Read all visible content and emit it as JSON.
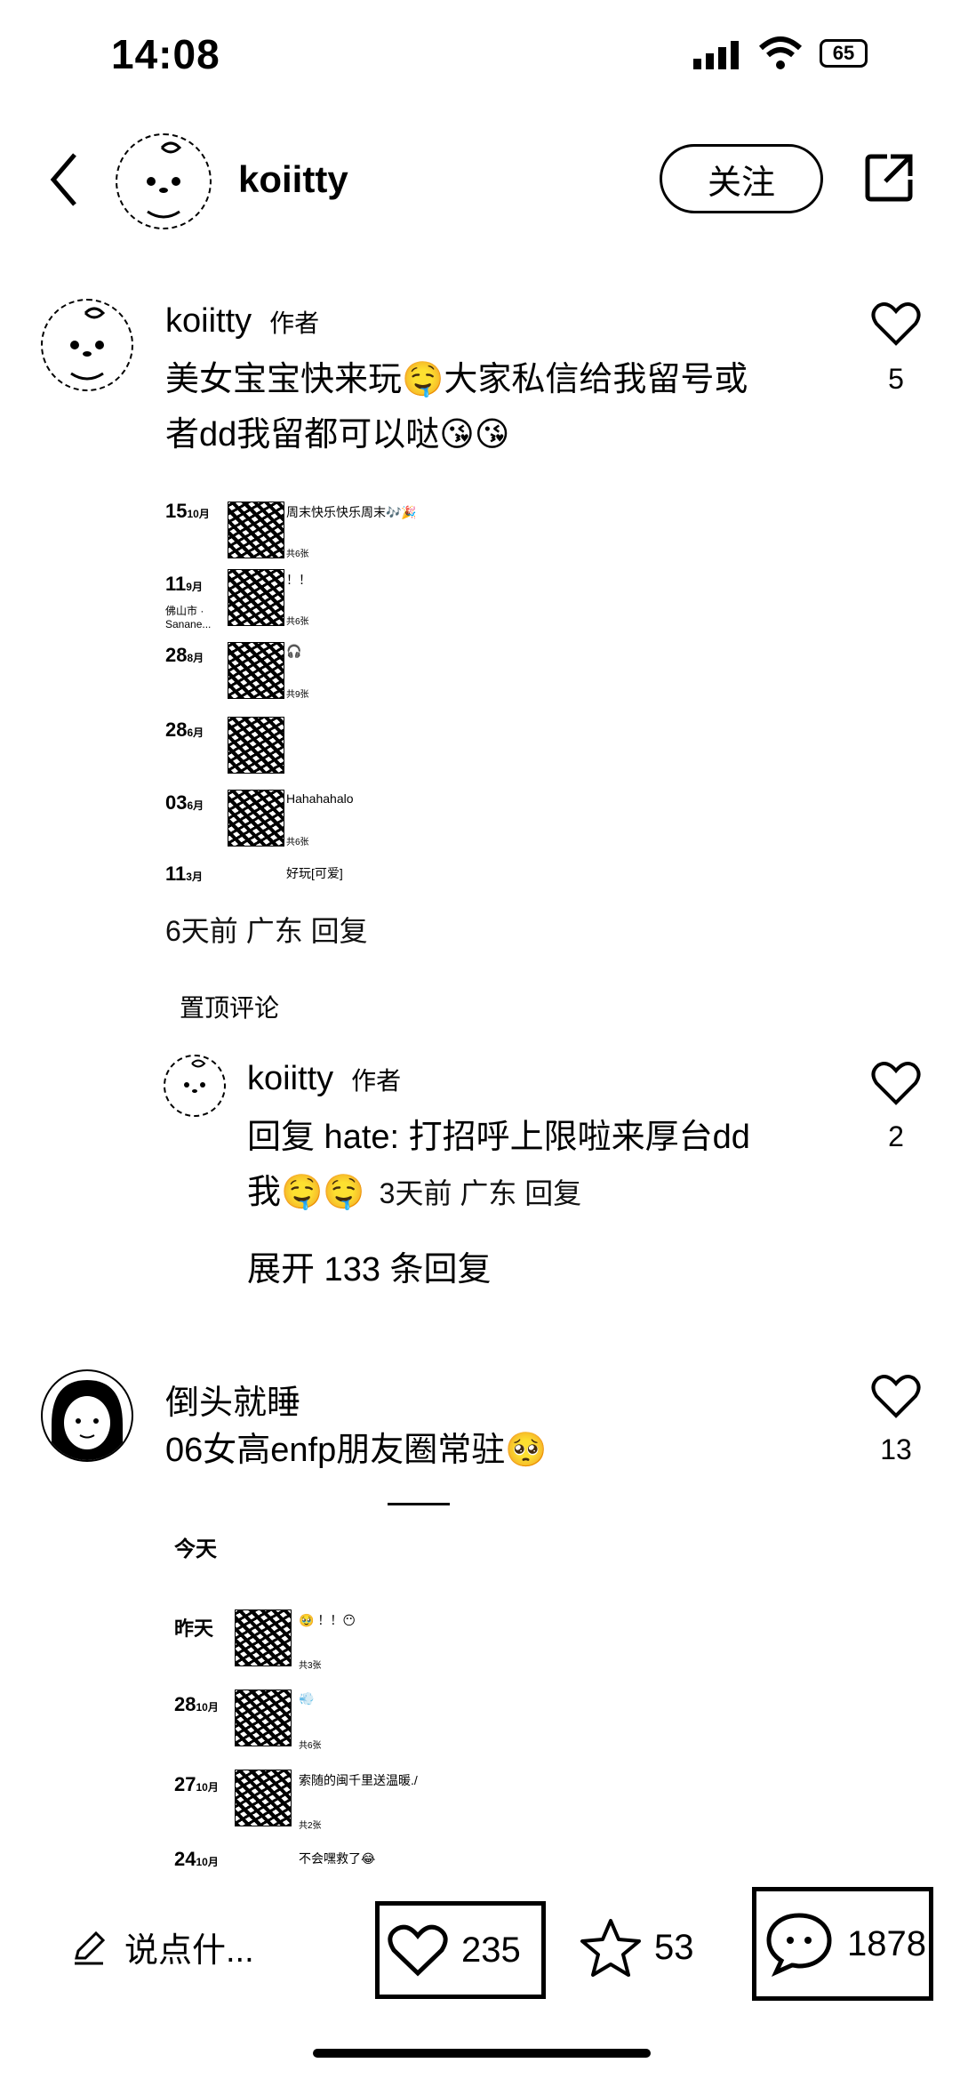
{
  "status_bar": {
    "time": "14:08",
    "battery": "65"
  },
  "header": {
    "username": "koiitty",
    "follow_label": "关注"
  },
  "comments": [
    {
      "username": "koiitty",
      "tag": "作者",
      "text_line1": "美女宝宝快来玩🤤大家私信给我留号或",
      "text_line2": "者dd我留都可以哒😘😘",
      "likes": "5",
      "meta": "6天前 广东 回复",
      "pinned_label": "置顶评论",
      "screenshot": {
        "rows": [
          {
            "day": "15",
            "month": "10月",
            "caption": "周末快乐快乐周末🎶🎉",
            "count": "共6张"
          },
          {
            "day": "11",
            "month": "9月",
            "sub": "佛山市 · Sanane...",
            "caption": "！！",
            "count": "共6张"
          },
          {
            "day": "28",
            "month": "8月",
            "caption": "🎧",
            "count": "共9张"
          },
          {
            "day": "28",
            "month": "6月",
            "caption": "",
            "count": ""
          },
          {
            "day": "03",
            "month": "6月",
            "caption": "Hahahahalo",
            "count": "共6张"
          },
          {
            "day": "11",
            "month": "3月",
            "caption": "好玩[可爱]",
            "count": ""
          }
        ]
      },
      "reply": {
        "username": "koiitty",
        "tag": "作者",
        "text_line1": "回复 hate: 打招呼上限啦来厚台dd",
        "text_line2_prefix": "我🤤🤤",
        "meta": "3天前 广东 回复",
        "likes": "2"
      },
      "expand_label": "展开 133 条回复"
    },
    {
      "username": "倒头就睡",
      "text_line1": "06女高enfp朋友圈常驻🥺",
      "likes": "13",
      "screenshot": {
        "today_label": "今天",
        "rows": [
          {
            "day": "昨天",
            "month": "",
            "caption": "🥹 ！！😶",
            "count": "共3张"
          },
          {
            "day": "28",
            "month": "10月",
            "caption": "💨",
            "count": "共6张"
          },
          {
            "day": "27",
            "month": "10月",
            "caption": "索随的闽千里送温暖./",
            "count": "共2张"
          },
          {
            "day": "24",
            "month": "10月",
            "caption": "不会嘿救了😂",
            "count": ""
          }
        ]
      }
    }
  ],
  "bottom_bar": {
    "input_placeholder": "说点什...",
    "likes": "235",
    "favorites": "53",
    "comments": "1878"
  }
}
